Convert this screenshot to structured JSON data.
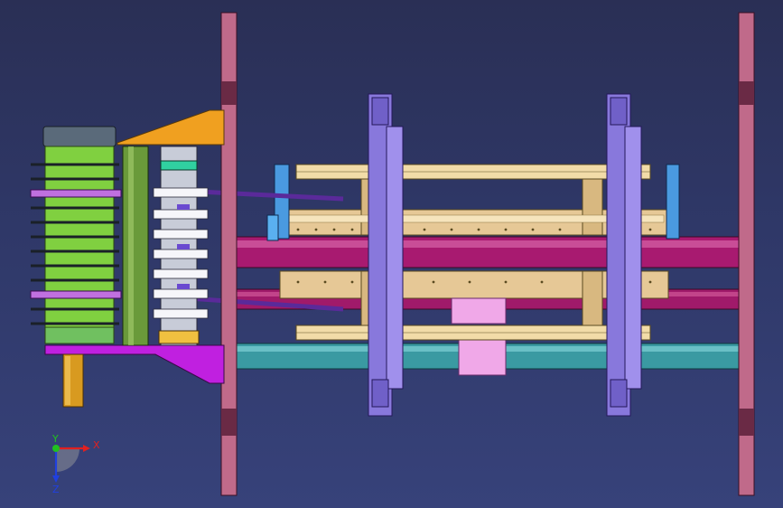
{
  "viewport": {
    "background": [
      "#2a2f55",
      "#37427a"
    ]
  },
  "triad": {
    "x_label": "X",
    "y_label": "Y",
    "z_label": "Z",
    "x_color": "#e02020",
    "y_color": "#20c020",
    "z_color": "#2040e0"
  },
  "colors": {
    "frame_plate": "#c06a8a",
    "frame_plate_dark": "#6a2a45",
    "main_shaft": "#b0206a",
    "lower_shaft": "#30a0a8",
    "rail": "#f0d8a0",
    "rail_edge": "#5a4a20",
    "carriage": "#e8c89a",
    "bracket": "#8a7ae0",
    "mount_plate": "#f0a020",
    "base_plate": "#c020e0",
    "drum_green": "#80d040",
    "post": "#70a040",
    "pink_block": "#f0a0e0",
    "blue_guide": "#50a0e0"
  }
}
